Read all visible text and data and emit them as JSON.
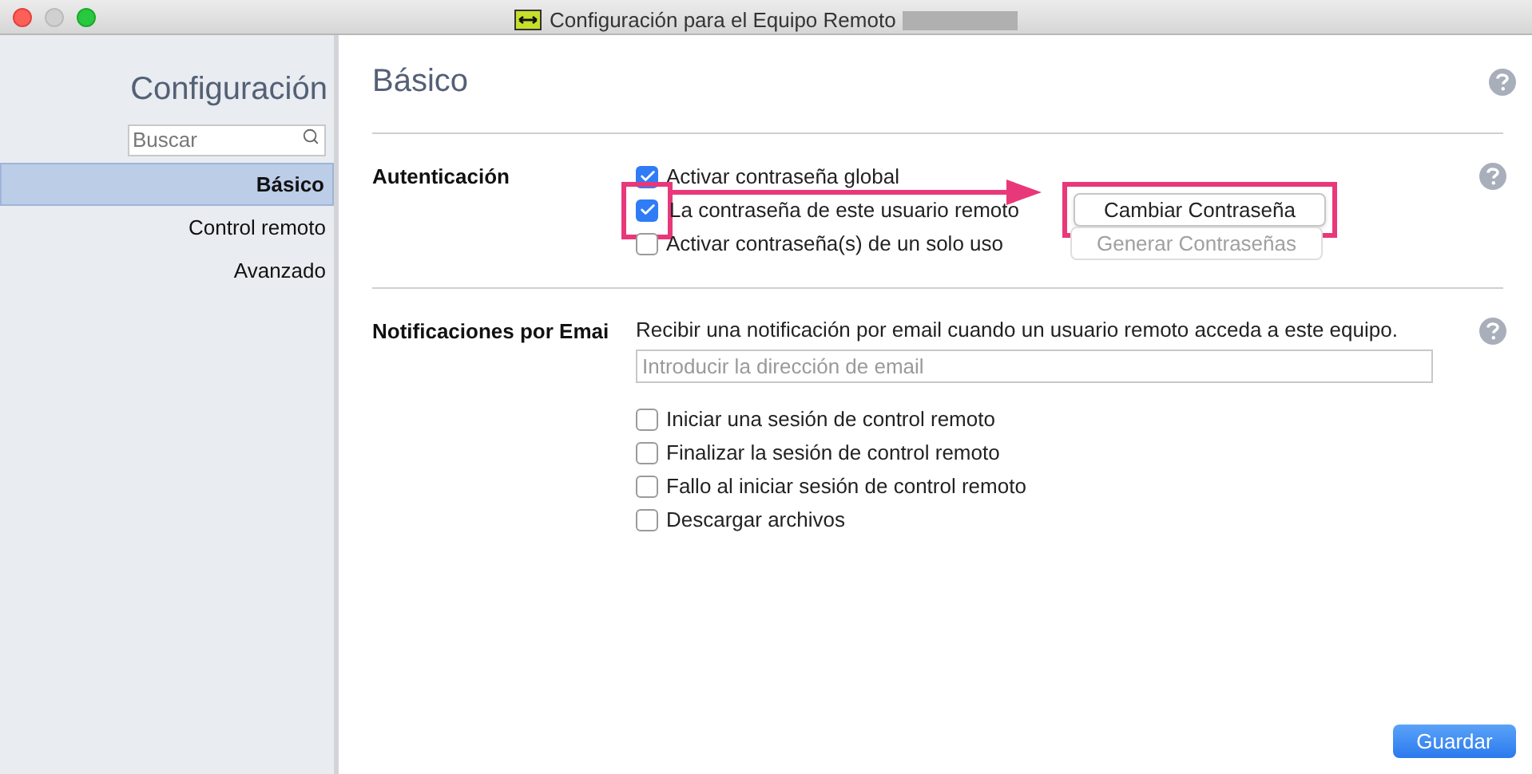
{
  "window": {
    "title": "Configuración para el Equipo Remoto"
  },
  "sidebar": {
    "title": "Configuración",
    "search": {
      "placeholder": "Buscar"
    },
    "items": [
      {
        "label": "Básico",
        "selected": true
      },
      {
        "label": "Control remoto",
        "selected": false
      },
      {
        "label": "Avanzado",
        "selected": false
      }
    ]
  },
  "page": {
    "title": "Básico"
  },
  "sections": [
    {
      "label": "Autenticación",
      "rows": [
        {
          "kind": "checkbox",
          "label": "Activar contraseña global",
          "checked": true,
          "highlighted": false
        },
        {
          "kind": "checkbox",
          "label": "La contraseña de este usuario remoto",
          "checked": true,
          "highlighted": true,
          "button": {
            "label": "Cambiar Contraseña",
            "disabled": false,
            "highlighted": true
          }
        },
        {
          "kind": "checkbox",
          "label": "Activar contraseña(s) de un solo uso",
          "checked": false,
          "highlighted": false,
          "button": {
            "label": "Generar Contraseñas",
            "disabled": true,
            "highlighted": false
          }
        }
      ]
    },
    {
      "label": "Notificaciones por Emai",
      "rows": [
        {
          "kind": "text",
          "label": "Recibir una notificación por email cuando un usuario remoto acceda a este equipo."
        },
        {
          "kind": "input",
          "placeholder": "Introducir la dirección de email"
        },
        {
          "kind": "checkbox",
          "label": "Iniciar una sesión de control remoto",
          "checked": false,
          "highlighted": false
        },
        {
          "kind": "checkbox",
          "label": "Finalizar la sesión de control remoto",
          "checked": false,
          "highlighted": false
        },
        {
          "kind": "checkbox",
          "label": "Fallo al iniciar sesión de control remoto",
          "checked": false,
          "highlighted": false
        },
        {
          "kind": "checkbox",
          "label": "Descargar archivos",
          "checked": false,
          "highlighted": false
        }
      ]
    }
  ],
  "save_button": {
    "label": "Guardar"
  }
}
